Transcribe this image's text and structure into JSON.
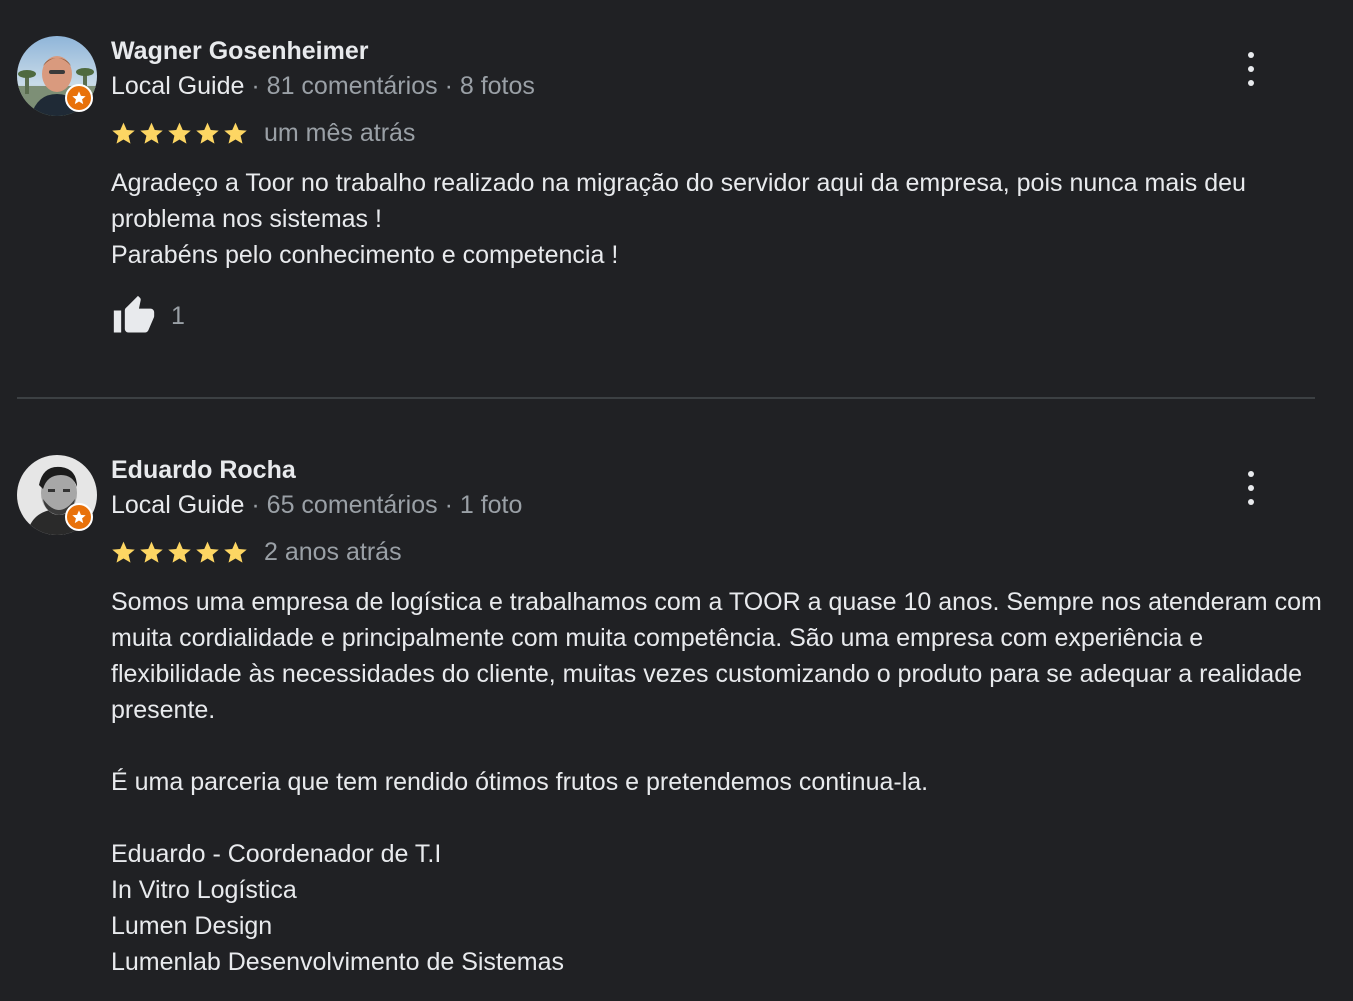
{
  "colors": {
    "background": "#202124",
    "text_primary": "#e8eaed",
    "text_secondary": "#9aa0a6",
    "star": "#fdd663",
    "local_guide_badge": "#e8710a",
    "divider": "#3c4043"
  },
  "reviews": [
    {
      "author": "Wagner Gosenheimer",
      "badge": "Local Guide",
      "reviews_count": "81 comentários",
      "photos_count": "8 fotos",
      "rating": 5,
      "date": "um mês atrás",
      "text": "Agradeço a Toor no trabalho realizado na migração do servidor aqui da empresa, pois nunca mais deu problema nos sistemas !\nParabéns pelo conhecimento e competencia !",
      "likes": "1",
      "icons": {
        "more": "more-vert-icon",
        "like": "thumbs-up-icon",
        "badge": "local-guide-star-icon"
      }
    },
    {
      "author": "Eduardo Rocha",
      "badge": "Local Guide",
      "reviews_count": "65 comentários",
      "photos_count": "1 foto",
      "rating": 5,
      "date": "2 anos atrás",
      "text": "Somos uma empresa de logística e trabalhamos com a TOOR a quase 10 anos. Sempre nos atenderam com muita cordialidade e principalmente com muita competência. São uma empresa com experiência e flexibilidade às necessidades do cliente, muitas vezes customizando o produto para se adequar a realidade presente.\n\nÉ uma parceria que tem rendido ótimos frutos e pretendemos continua-la.\n\nEduardo - Coordenador de T.I\nIn Vitro Logística\nLumen Design\nLumenlab Desenvolvimento de Sistemas",
      "icons": {
        "more": "more-vert-icon",
        "badge": "local-guide-star-icon"
      }
    }
  ]
}
